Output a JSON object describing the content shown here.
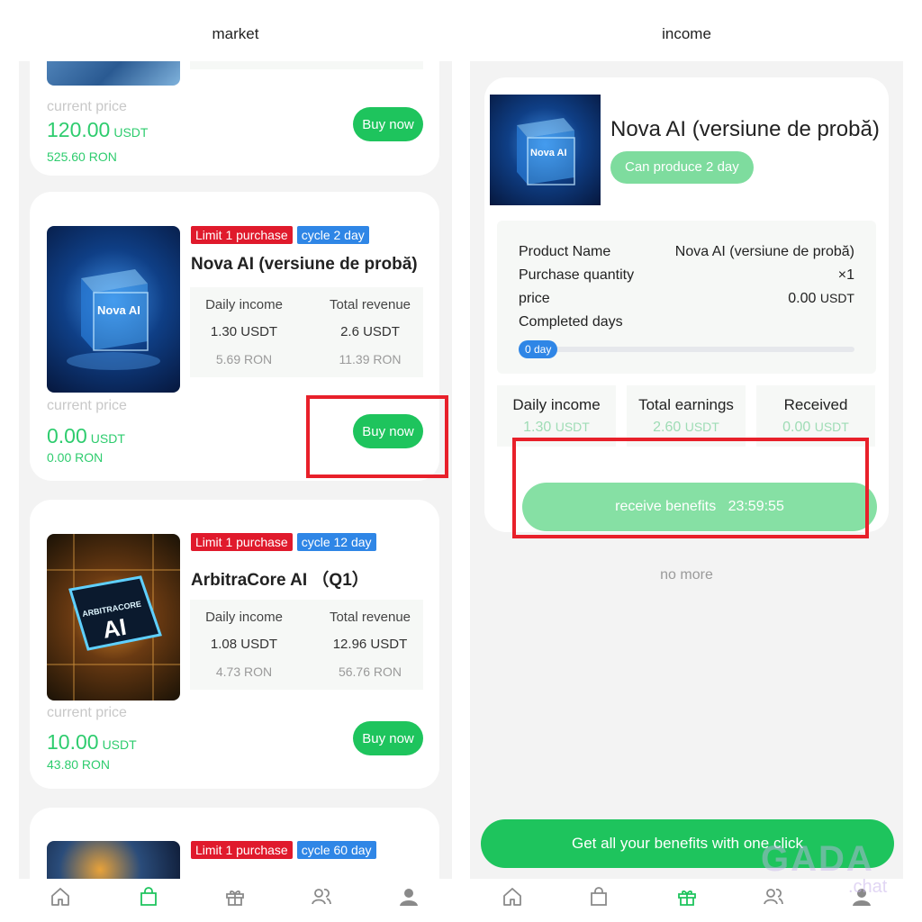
{
  "left": {
    "title": "market",
    "common": {
      "current_price_label": "current price",
      "buy_label": "Buy now",
      "daily_income_label": "Daily income",
      "total_revenue_label": "Total revenue",
      "unit": "USDT"
    },
    "top_card": {
      "price": "120.00",
      "price_ron": "525.60 RON"
    },
    "products": [
      {
        "tag_limit": "Limit 1 purchase",
        "tag_cycle": "cycle 2 day",
        "name": "Nova AI (versiune de probă)",
        "daily_income": "1.30 USDT",
        "daily_income_ron": "5.69 RON",
        "total_revenue": "2.6 USDT",
        "total_revenue_ron": "11.39 RON",
        "price": "0.00",
        "price_ron": "0.00 RON",
        "image_text": "Nova AI"
      },
      {
        "tag_limit": "Limit 1 purchase",
        "tag_cycle": "cycle 12 day",
        "name": "ArbitraCore AI （Q1）",
        "daily_income": "1.08 USDT",
        "daily_income_ron": "4.73 RON",
        "total_revenue": "12.96 USDT",
        "total_revenue_ron": "56.76 RON",
        "price": "10.00",
        "price_ron": "43.80 RON",
        "image_text": "ARBITRACORE AI"
      },
      {
        "tag_limit": "Limit 1 purchase",
        "tag_cycle": "cycle 60 day"
      }
    ],
    "nav": [
      "home-icon",
      "bag-icon",
      "gift-icon",
      "team-icon",
      "profile-icon"
    ],
    "active_nav": "bag-icon"
  },
  "right": {
    "title": "income",
    "product_title": "Nova AI (versiune de probă)",
    "can_produce": "Can produce 2 day",
    "details": {
      "product_name_label": "Product Name",
      "product_name_value": "Nova AI (versiune de probă)",
      "quantity_label": "Purchase quantity",
      "quantity_value": "×1",
      "price_label": "price",
      "price_value": "0.00",
      "price_unit": "USDT",
      "completed_label": "Completed days",
      "completed_badge": "0 day",
      "progress": 0
    },
    "stats": [
      {
        "label": "Daily income",
        "value": "1.30",
        "unit": "USDT"
      },
      {
        "label": "Total earnings",
        "value": "2.60",
        "unit": "USDT"
      },
      {
        "label": "Received",
        "value": "0.00",
        "unit": "USDT"
      }
    ],
    "receive_label": "receive benefits",
    "countdown": "23:59:55",
    "no_more": "no more",
    "get_all_label": "Get all your benefits with one click",
    "nav": [
      "home-icon",
      "bag-icon",
      "gift-icon",
      "team-icon",
      "profile-icon"
    ],
    "active_nav": "gift-icon"
  },
  "watermark": {
    "text": "GADA",
    "sub": ".chat"
  },
  "colors": {
    "accent": "#1ec45d",
    "highlight": "#e8202a",
    "tag_red": "#e01a2c",
    "tag_blue": "#2f86e6"
  }
}
